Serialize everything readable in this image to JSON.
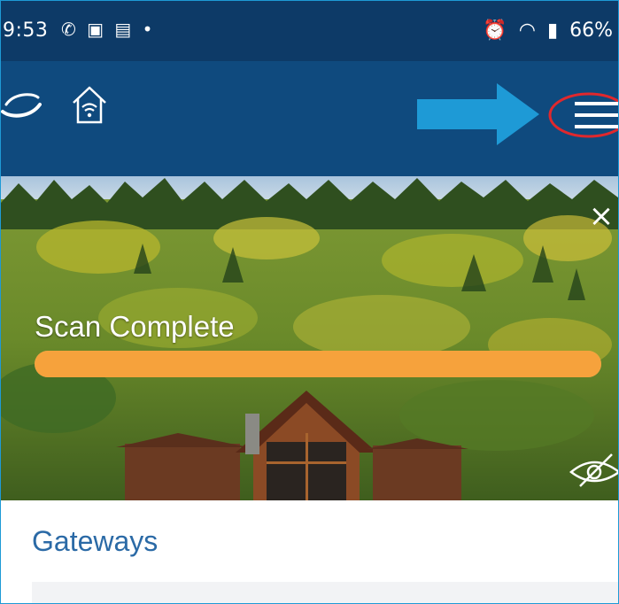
{
  "status_bar": {
    "time": "9:53",
    "left_icons": [
      "whatsapp-icon",
      "teams-icon",
      "outlook-icon",
      "dot-icon"
    ],
    "right_icons": [
      "alarm-icon",
      "wifi-icon",
      "call-icon",
      "signal-icon"
    ],
    "battery": "66%"
  },
  "app_bar": {
    "logo": "logo-swirl",
    "home_icon": "smart-home-icon",
    "annotation_arrow_color": "#1e9ad6",
    "annotation_circle_color": "#e0282d",
    "menu_icon": "hamburger-menu-icon"
  },
  "hero": {
    "close_label": "×",
    "scan_title": "Scan Complete",
    "progress_percent": 100,
    "progress_color": "#f6a23c",
    "eye_icon": "eye-slash-icon"
  },
  "section": {
    "title": "Gateways"
  },
  "colors": {
    "statusbar_bg": "#0d3a67",
    "appbar_bg": "#0f4a7e",
    "section_title": "#2b6aa6"
  }
}
